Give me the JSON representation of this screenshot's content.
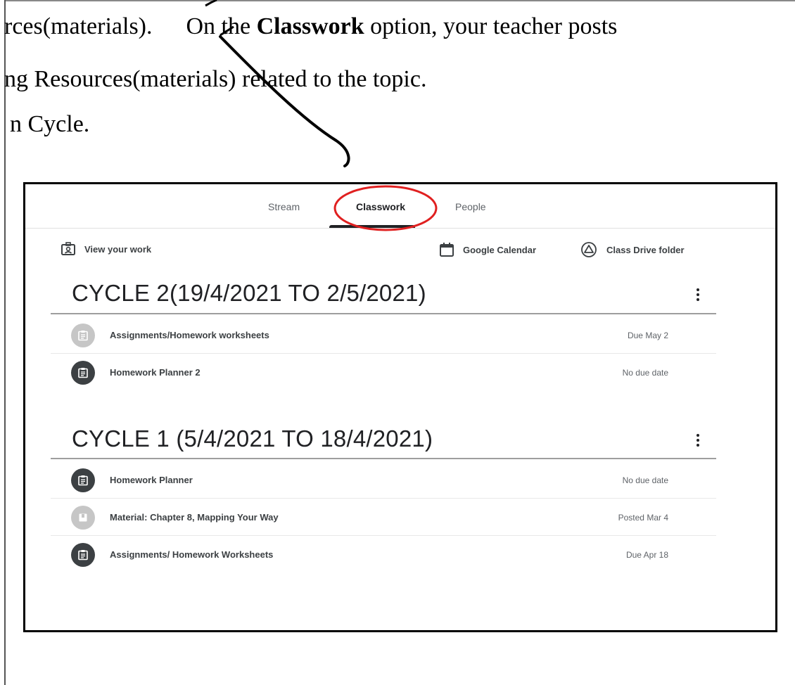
{
  "document": {
    "line1_start": "rces(materials).",
    "line1_mid": "On the ",
    "line1_bold": "Classwork",
    "line1_end": " option, your teacher posts",
    "line2": "ng Resources(materials) related to the topic.",
    "line3": "n Cycle."
  },
  "tabs": [
    "Stream",
    "Classwork",
    "People"
  ],
  "toolbar": {
    "view_work": "View your work",
    "calendar": "Google Calendar",
    "drive": "Class Drive folder"
  },
  "topics": [
    {
      "title": "CYCLE 2(19/4/2021 TO 2/5/2021)",
      "items": [
        {
          "title": "Assignments/Homework worksheets",
          "due": "Due May 2",
          "icon": "assignment-icon",
          "style": "light"
        },
        {
          "title": "Homework Planner 2",
          "due": "No due date",
          "icon": "assignment-icon",
          "style": "dark"
        }
      ]
    },
    {
      "title": "CYCLE 1 (5/4/2021 TO 18/4/2021)",
      "items": [
        {
          "title": "Homework Planner",
          "due": "No due date",
          "icon": "assignment-icon",
          "style": "dark"
        },
        {
          "title": "Material: Chapter 8, Mapping Your Way",
          "due": "Posted Mar 4",
          "icon": "material-icon",
          "style": "light"
        },
        {
          "title": "Assignments/ Homework Worksheets",
          "due": "Due Apr 18",
          "icon": "assignment-icon",
          "style": "dark"
        }
      ]
    }
  ],
  "annotation": {
    "highlight_color": "#e02020",
    "arrow_color": "#000000"
  }
}
